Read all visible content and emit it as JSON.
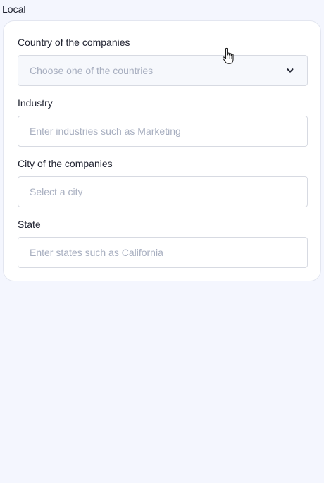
{
  "section": {
    "title": "Local"
  },
  "form": {
    "country": {
      "label": "Country of the companies",
      "placeholder": "Choose one of the countries",
      "icon": "chevron-down-icon"
    },
    "industry": {
      "label": "Industry",
      "placeholder": "Enter industries such as Marketing"
    },
    "city": {
      "label": "City of the companies",
      "placeholder": "Select a city"
    },
    "state": {
      "label": "State",
      "placeholder": "Enter states such as California"
    }
  },
  "colors": {
    "page_background": "#f4f6fe",
    "card_background": "#ffffff",
    "label_text": "#1f2230",
    "placeholder_text": "#a8afc0",
    "border": "#d7dae2"
  }
}
